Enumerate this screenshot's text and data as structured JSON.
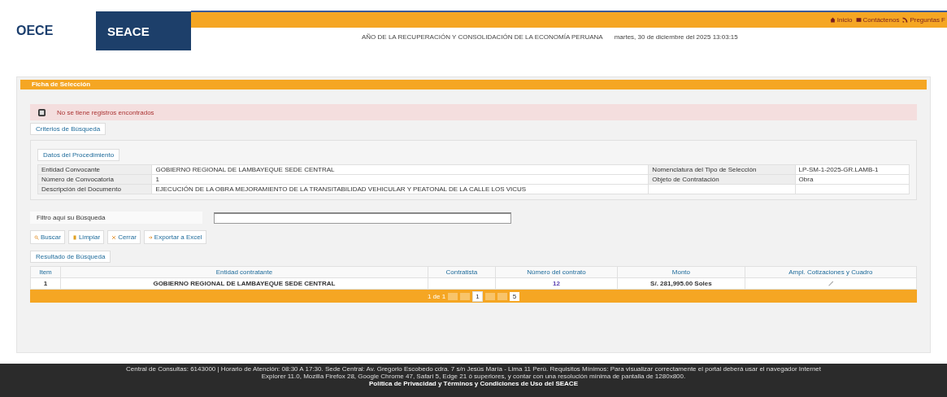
{
  "header": {
    "logos": [
      "OECE",
      "SEACE"
    ],
    "nav": [
      {
        "label": "Inicio"
      },
      {
        "label": "Contáctenos"
      },
      {
        "label": "Preguntas F"
      }
    ],
    "motto": "AÑO DE LA RECUPERACIÓN Y CONSOLIDACIÓN DE LA ECONOMÍA PERUANA",
    "datetime": "martes, 30 de diciembre del 2025 13:03:15"
  },
  "panel": {
    "title": "Ficha de Selección",
    "message": "No se tiene registros encontrados",
    "criteria_tab": "Criterios de Búsqueda",
    "procedure_tab": "Datos del Procedimiento",
    "fields": [
      {
        "label": "Entidad Convocante",
        "value": "GOBIERNO REGIONAL DE LAMBAYEQUE SEDE CENTRAL"
      },
      {
        "label": "Nomenclatura del Tipo de Selección",
        "value": "LP-SM-1-2025-GR.LAMB-1"
      },
      {
        "label": "Número de Convocatoria",
        "value": "1"
      },
      {
        "label": "Objeto de Contratación",
        "value": "Obra"
      },
      {
        "label": "Descripción del Documento",
        "value": "EJECUCIÓN DE LA OBRA MEJORAMIENTO DE LA TRANSITABILIDAD VEHICULAR Y PEATONAL DE LA CALLE LOS VICUS"
      }
    ],
    "filter_label": "Filtro aquí su Búsqueda",
    "buttons": [
      {
        "label": "Buscar"
      },
      {
        "label": "Limpiar"
      },
      {
        "label": "Cerrar"
      },
      {
        "label": "Exportar a Excel"
      }
    ],
    "results_tab": "Resultado de Búsqueda",
    "table": {
      "columns": [
        "Item",
        "Entidad contratante",
        "Contratista",
        "Número del contrato",
        "Monto",
        "Ampl. Cotizaciones y Cuadro"
      ],
      "rows": [
        {
          "item": "1",
          "entity": "GOBIERNO REGIONAL DE LAMBAYEQUE SEDE CENTRAL",
          "number": "12",
          "amount": "S/. 281,995.00 Soles"
        }
      ]
    },
    "pager": {
      "summary": "1 de 1",
      "pages": [
        {
          "label": "1",
          "selected": true
        }
      ],
      "page_size": "5"
    }
  },
  "footer": {
    "lines": [
      "Central de Consultas: 6143000 | Horario de Atención: 08:30 A 17:30. Sede Central: Av. Gregorio Escobedo cdra. 7 s/n Jesús María - Lima 11 Perú. Requisitos Mínimos: Para visualizar correctamente el portal deberá usar el navegador Internet Explorer 11.0, Mozilla Firefox 28, Google Chrome 47, Safari 5, Edge 21 ó superiores, y contar con una resolución mínima de pantalla de 1280x800."
    ],
    "policy": "Política de Privacidad y Términos y Condiciones de Uso del SEACE"
  }
}
